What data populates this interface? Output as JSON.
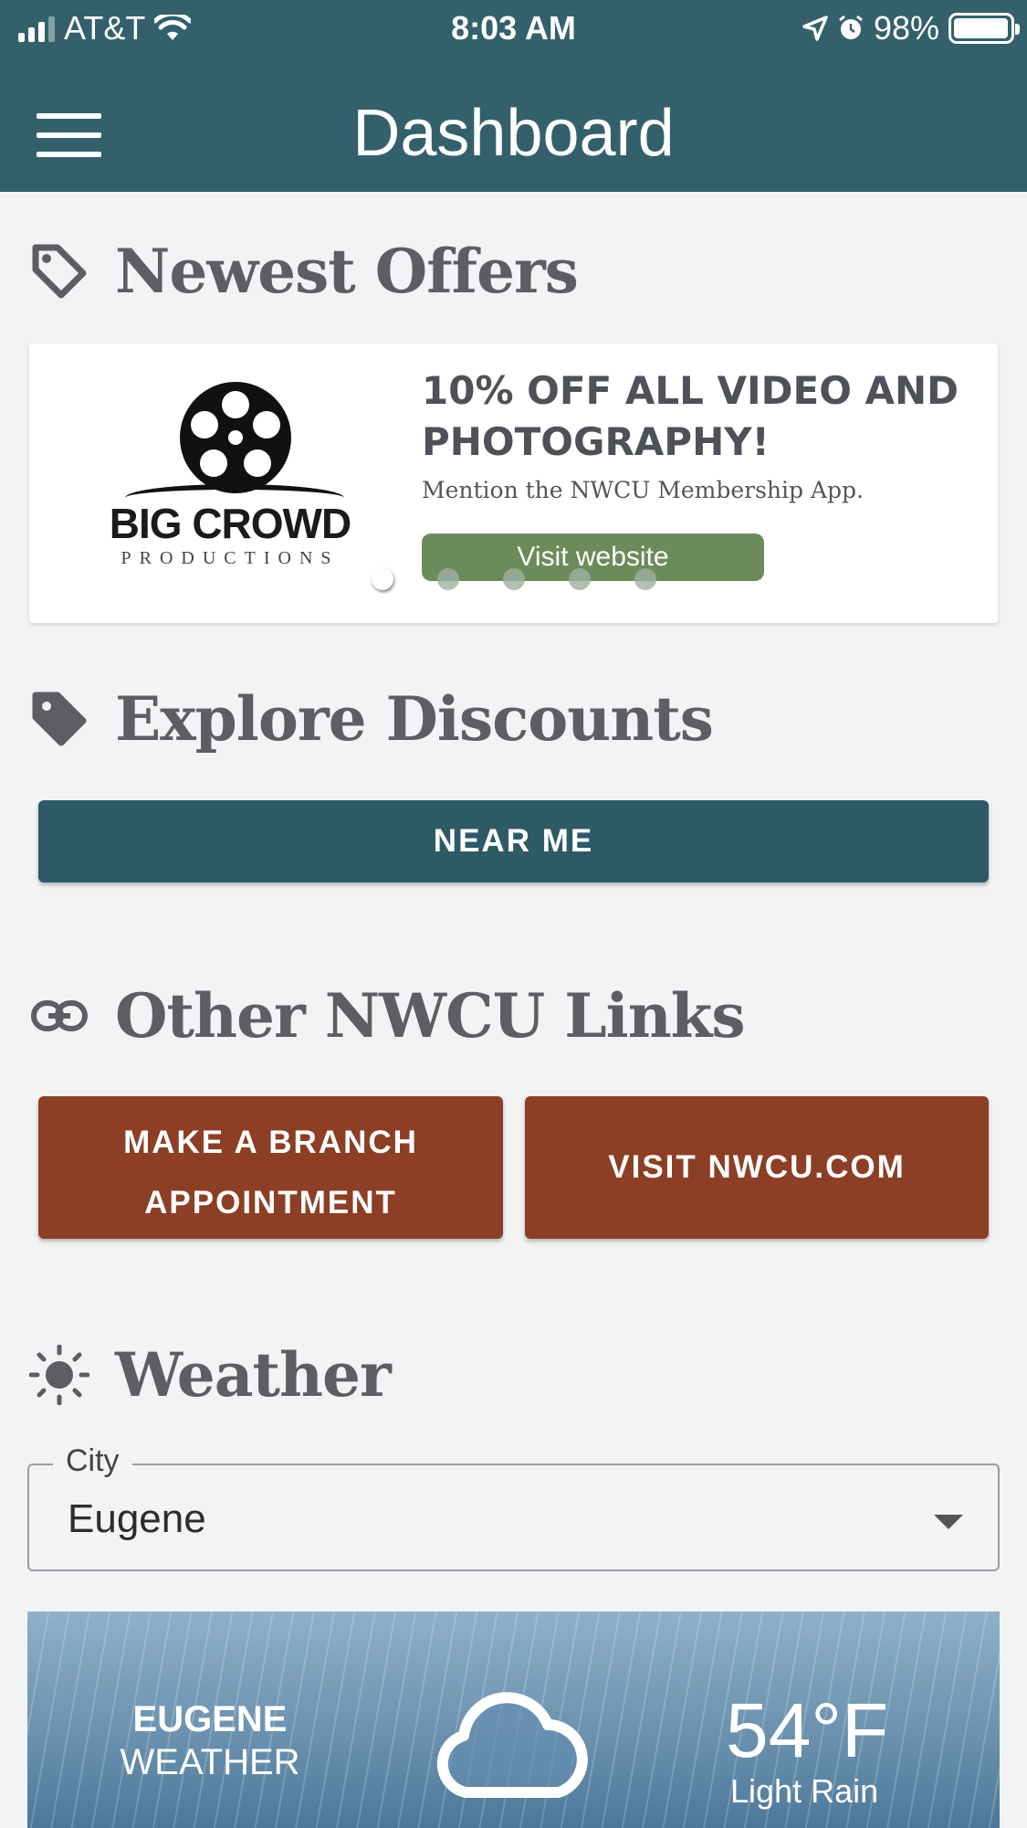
{
  "status_bar": {
    "carrier": "AT&T",
    "time": "8:03 AM",
    "battery": "98%",
    "battery_level": 0.98
  },
  "header": {
    "title": "Dashboard"
  },
  "sections": {
    "offers_title": "Newest Offers",
    "discounts_title": "Explore Discounts",
    "links_title": "Other NWCU Links",
    "weather_title": "Weather"
  },
  "offer": {
    "brand": "BIG CROWD",
    "brand_sub": "PRODUCTIONS",
    "headline": "10% OFF ALL VIDEO AND PHOTOGRAPHY!",
    "subtext": "Mention the NWCU Membership App.",
    "button": "Visit website",
    "carousel_count": 5,
    "carousel_active": 1
  },
  "discounts": {
    "near_me": "NEAR ME"
  },
  "links": {
    "branch": "MAKE A BRANCH APPOINTMENT",
    "nwcu": "VISIT NWCU.COM"
  },
  "weather": {
    "city_label": "City",
    "city_value": "Eugene",
    "card_city": "EUGENE",
    "card_weather": "WEATHER",
    "temperature": "54°F",
    "condition": "Light Rain"
  },
  "colors": {
    "header": "#33606b",
    "primary_button": "#2e5a66",
    "link_button": "#8c3f24",
    "offer_button": "#6b8c5a"
  },
  "icons": [
    "menu-icon",
    "tag-icon",
    "link-icon",
    "sun-icon",
    "cloud-icon",
    "dropdown-arrow-icon"
  ]
}
